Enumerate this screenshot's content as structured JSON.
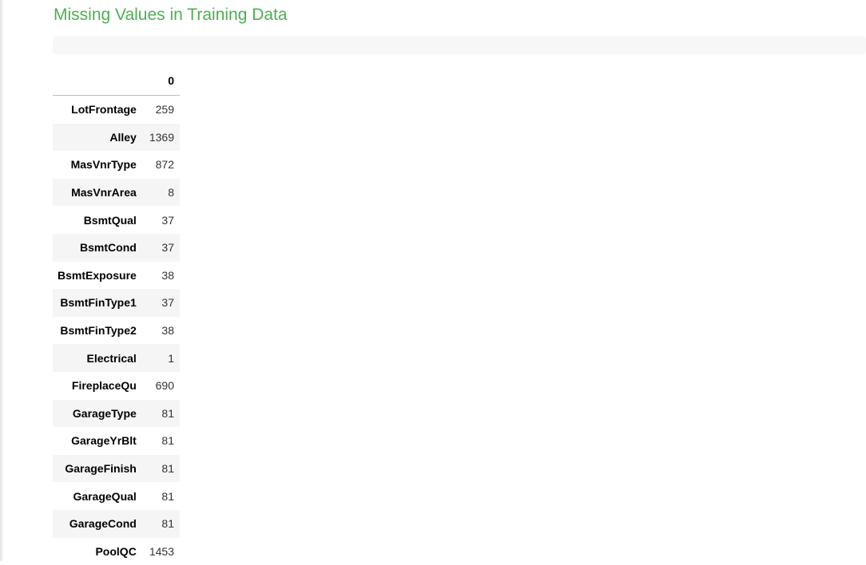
{
  "title": "Missing Values in Training Data",
  "table": {
    "column_header": "0",
    "rows": [
      {
        "label": "LotFrontage",
        "value": "259"
      },
      {
        "label": "Alley",
        "value": "1369"
      },
      {
        "label": "MasVnrType",
        "value": "872"
      },
      {
        "label": "MasVnrArea",
        "value": "8"
      },
      {
        "label": "BsmtQual",
        "value": "37"
      },
      {
        "label": "BsmtCond",
        "value": "37"
      },
      {
        "label": "BsmtExposure",
        "value": "38"
      },
      {
        "label": "BsmtFinType1",
        "value": "37"
      },
      {
        "label": "BsmtFinType2",
        "value": "38"
      },
      {
        "label": "Electrical",
        "value": "1"
      },
      {
        "label": "FireplaceQu",
        "value": "690"
      },
      {
        "label": "GarageType",
        "value": "81"
      },
      {
        "label": "GarageYrBlt",
        "value": "81"
      },
      {
        "label": "GarageFinish",
        "value": "81"
      },
      {
        "label": "GarageQual",
        "value": "81"
      },
      {
        "label": "GarageCond",
        "value": "81"
      },
      {
        "label": "PoolQC",
        "value": "1453"
      }
    ]
  },
  "colors": {
    "title": "#4caf50",
    "stripe": "#f5f5f5",
    "code_cell_bg": "#f7f7f7"
  }
}
